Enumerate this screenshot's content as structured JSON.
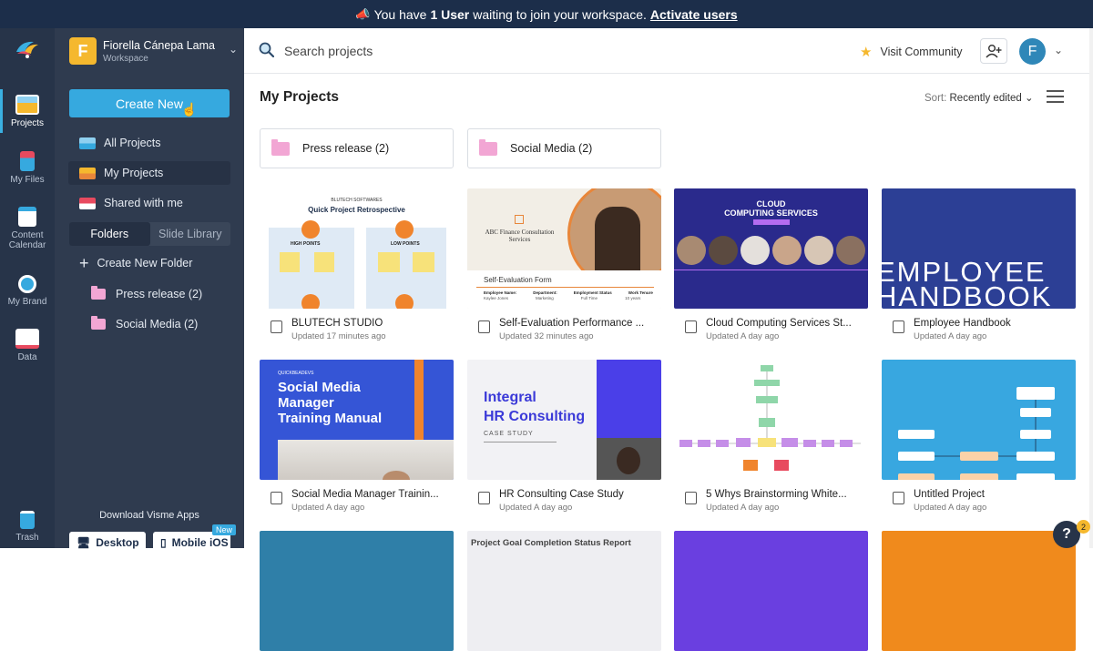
{
  "banner": {
    "prefix": "You have",
    "count_text": "1 User",
    "suffix": "waiting to join your workspace.",
    "link": "Activate users"
  },
  "rail": {
    "items": [
      {
        "label": "Projects",
        "icon": "projects-icon"
      },
      {
        "label": "My Files",
        "icon": "files-icon"
      },
      {
        "label": "Content",
        "label2": "Calendar",
        "icon": "calendar-icon"
      },
      {
        "label": "My Brand",
        "icon": "brand-icon"
      },
      {
        "label": "Data",
        "icon": "data-icon"
      },
      {
        "label": "Trash",
        "icon": "trash-icon"
      }
    ]
  },
  "workspace": {
    "initial": "F",
    "name": "Fiorella Cánepa Lama",
    "type": "Workspace"
  },
  "sidebar": {
    "create_label": "Create New",
    "nav": [
      {
        "label": "All Projects"
      },
      {
        "label": "My Projects"
      },
      {
        "label": "Shared with me"
      }
    ],
    "tabs": [
      "Folders",
      "Slide Library"
    ],
    "new_folder": "Create New Folder",
    "folders": [
      "Press release (2)",
      "Social Media (2)"
    ],
    "download_label": "Download Visme Apps",
    "desktop_label": "Desktop",
    "mobile_label": "Mobile iOS",
    "new_badge": "New"
  },
  "topbar": {
    "search_placeholder": "Search projects",
    "community_label": "Visit Community",
    "user_initial": "F"
  },
  "main": {
    "title": "My Projects",
    "sort_prefix": "Sort:",
    "sort_value": "Recently edited",
    "folders": [
      "Press release  (2)",
      "Social Media  (2)"
    ],
    "projects": [
      {
        "title": "BLUTECH STUDIO",
        "updated": "Updated 17 minutes ago"
      },
      {
        "title": "Self-Evaluation Performance ...",
        "updated": "Updated 32 minutes ago"
      },
      {
        "title": "Cloud Computing Services St...",
        "updated": "Updated A day ago"
      },
      {
        "title": "Employee Handbook",
        "updated": "Updated A day ago"
      },
      {
        "title": "Social Media Manager Trainin...",
        "updated": "Updated A day ago"
      },
      {
        "title": "HR Consulting Case Study",
        "updated": "Updated A day ago"
      },
      {
        "title": "5 Whys Brainstorming White...",
        "updated": "Updated A day ago"
      },
      {
        "title": "Untitled Project",
        "updated": "Updated A day ago"
      }
    ],
    "thumbs": {
      "t1_brand": "BLUTECH SOFTWARES",
      "t1_title": "Quick Project Retrospective",
      "t1_high": "HIGH POINTS",
      "t1_low": "LOW POINTS",
      "t2_company": "ABC Finance Consultation Services",
      "t2_form": "Self-Evaluation Form",
      "t2_cols": [
        "Employee Name:",
        "Department:",
        "Employment Status",
        "Work Tenure"
      ],
      "t2_vals": [
        "Kaylee Jones",
        "Marketing",
        "Full Time",
        "10 years"
      ],
      "t3_title1": "CLOUD",
      "t3_title2": "COMPUTING SERVICES",
      "t4_line1": "EMPLOYEE",
      "t4_line2": "HANDBOOK",
      "t5_small": "QUICKBEADEVS",
      "t5_l1": "Social Media",
      "t5_l2": "Manager",
      "t5_l3": "Training Manual",
      "t6_l1": "Integral",
      "t6_l2": "HR Consulting",
      "t6_sub": "CASE STUDY",
      "t9_title": "Project Goal Completion Status Report"
    }
  },
  "help": {
    "label": "?",
    "badge": "2"
  },
  "colors": {
    "banner": "#1c2e4a",
    "rail": "#273449",
    "panel": "#2f3b4f",
    "accent": "#36a9df",
    "star": "#f5b82e"
  }
}
